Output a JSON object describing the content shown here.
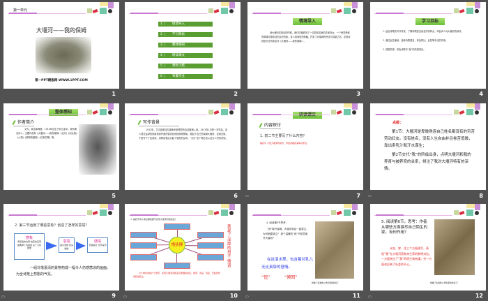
{
  "slides": [
    {
      "number": "1",
      "unit": "第一单元",
      "title": "大堰河——我的保姆",
      "caption": "第一PPT模板网-WWW.1PPT.COM"
    },
    {
      "number": "2",
      "menu": [
        {
          "n": "1",
          "label": "情境导入"
        },
        {
          "n": "2",
          "label": "学习目标"
        },
        {
          "n": "3",
          "label": "整体感知"
        },
        {
          "n": "4",
          "label": "研读课文"
        },
        {
          "n": "5",
          "label": "课文小结"
        },
        {
          "n": "6",
          "label": "布置作业"
        }
      ]
    },
    {
      "number": "3",
      "heading": "情境导入",
      "body": "读大堰河这首诗的时候，我们仿佛看到了一位勤劳善良的农家妇女，一个受苦受难的普通中国劳动妇女的形象。诗人用深情的笔触，抒发了对保姆的怀念与感激之情。这首诗就是艾青的成名作《大堰河——我的保姆》。"
    },
    {
      "number": "4",
      "heading": "学习目标",
      "items": [
        "1. 结合诗歌的写作背景，了解诗歌的意象及抒情特点，体会诗人对大堰河的深情。",
        "2. 通过反复诵读，品味诗歌语言，体会排比、反复等手法的作用。",
        "3. 把握情感，体会诗歌中“我”的情感变化。"
      ]
    },
    {
      "number": "5",
      "heading": "整体感知",
      "subheading": "作者简介",
      "body": "艾青，原名蒋海澄，1910年出生于浙江金华。现代著名诗人。主要作品有《大堰河——我的保姆》《北方》《向太阳》《火把》《黎明的通知》《归来的歌》等。"
    },
    {
      "number": "6",
      "subheading": "写作背景",
      "body": "1932年，艾青因参加左翼美术家联盟的活动被捕入狱。1933年1月的一天早晨，诗人透过监狱的铁窗看到外面的雪花纷纷扬扬地飘落，想起了自己的保姆大堰河，百感交集，于是写下了这首诗。诗歌发表后引起了强烈的反响，“艾青”这个笔名也从此为人们所熟知。"
    },
    {
      "number": "7",
      "heading": "研读课文",
      "subheading": "内容探讨",
      "question": "1. 前二节主要写了什么内容？",
      "hint": "【提示】介绍大堰河的身份，抒发对她的深情与怀念。"
    },
    {
      "number": "8",
      "label": "点拨：",
      "p1": "第1节：大堰河是卑微得连自己姓名都没有的穷苦劳动妇女。没有姓名，没有人生自由并且卷苦低微，靠出卖乳汁和汗水谋生；",
      "p2": "第2节交代“我”的阶级出身，点明大堰河和我的养育与被养育的关系，倾注了我对大堰河特有的深情。"
    },
    {
      "number": "9",
      "question": "2. 第三节运用了哪些意象？创造了怎样的意境？",
      "box1_title": "意象",
      "box1_body": "雪压着的坟墓 枯死的瓦菲 被典押了的园地 关了门的故居",
      "box2_title": "意境",
      "box2_body": "凄冷萧瑟 荒凉破败",
      "box3_title": "感情",
      "box3_body": "悲痛思念 无尽哀伤",
      "summary": "一组冷落凄清的景物构成一幅令人伤感悲凉的画面。为全诗笼上悲剧的气氛。"
    },
    {
      "number": "10",
      "question": "3. 第四节诗人通过哪些细节表现大堰河对我的爱？",
      "center": "抱抚摸",
      "side": "表现了深厚的母子情谊",
      "footnote": "六个排比句的六个细节，表现大堰河对我深沉而细腻的爱，勤劳、善良、慈爱、无私的形象跃然纸上。"
    },
    {
      "number": "11",
      "prompt": "4. 阅读第5节思考：",
      "q": "“我”离开保姆，大堰河却会一直哭泣，为何她要哭泣？ 那个温暖的“我”不愿意离开大堰河？",
      "blue": "在这泪水里，包含着对乳儿无比真挚的感情。",
      "red1": "“忸”",
      "red2": "“倾回”",
      "caption": "我做了生我的父母家里的新客了"
    },
    {
      "number": "12",
      "q": "5. 阅读第6节，思考：作者从哪些方面描写自己陌生的家，有何作用？",
      "answer": "从吃、穿、住三个方面描写，表现“我”在大堰河家和亲生家的鲜明对比。一方面突出了“我”的陌生和拘谨；另一方面也反映了社会的不公。",
      "caption": "我做了生我的父母家里的新客了！"
    }
  ],
  "colors": {
    "accent_green": "#6cbf3a",
    "bar_green": "#5a9e32",
    "red": "#e02020",
    "blue": "#2a3ae0",
    "purple": "#c878d0"
  }
}
